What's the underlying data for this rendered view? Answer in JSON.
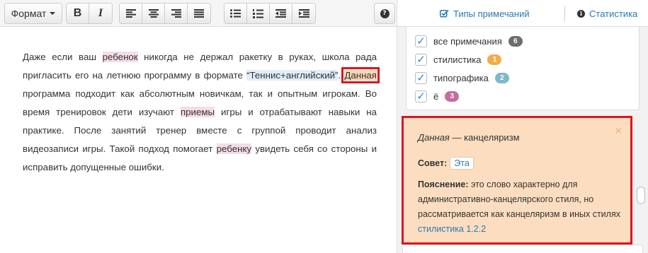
{
  "toolbar": {
    "format_label": "Формат",
    "bold_label": "B",
    "italic_label": "I",
    "help_label": "?"
  },
  "right_header": {
    "types_tab": "Типы примечаний",
    "stats_tab": "Статистика"
  },
  "editor": {
    "p1": "Даже если ваш ",
    "w_child1": "ребенок",
    "p2": " никогда не держал ракетку в руках, школа рада пригласить его на летнюю программу в формате ",
    "w_quote": "“Теннис+английский”",
    "p3": ". ",
    "w_dannaya": "Данная",
    "p4": " программа подходит как абсолютным новичкам, так и опытным игрокам. Во время тренировок дети изучают ",
    "w_priemy": "приемы",
    "p5": " игры и отрабатывают навыки на практике. После занятий тренер вместе с группой проводит анализ видеозаписи игры. Такой подход помогает ",
    "w_child2": "ребенку",
    "p6": " увидеть себя со стороны и исправить допущенные ошибки."
  },
  "filters": [
    {
      "label": "все примечания",
      "count": "6",
      "color": "#6d6d6d",
      "checked": true
    },
    {
      "label": "стилистика",
      "count": "1",
      "color": "#f0ad4e",
      "checked": true
    },
    {
      "label": "типографика",
      "count": "2",
      "color": "#7fb8c9",
      "checked": true
    },
    {
      "label": "ё",
      "count": "3",
      "color": "#c76c9e",
      "checked": true
    }
  ],
  "note": {
    "word": "Данная",
    "dash_text": " — канцеляризм",
    "close": "×",
    "advice_label": "Совет:",
    "advice_value": "Эта",
    "expl_label": "Пояснение:",
    "expl_text": " это слово характерно для административно-канцелярского стиля, но рассматривается как канцеляризм в иных стилях ",
    "expl_link": "стилистика 1.2.2"
  },
  "colors": {
    "accent": "#2a7ab0",
    "highlight_red": "#e0141e",
    "note_bg": "#fcddc0"
  }
}
